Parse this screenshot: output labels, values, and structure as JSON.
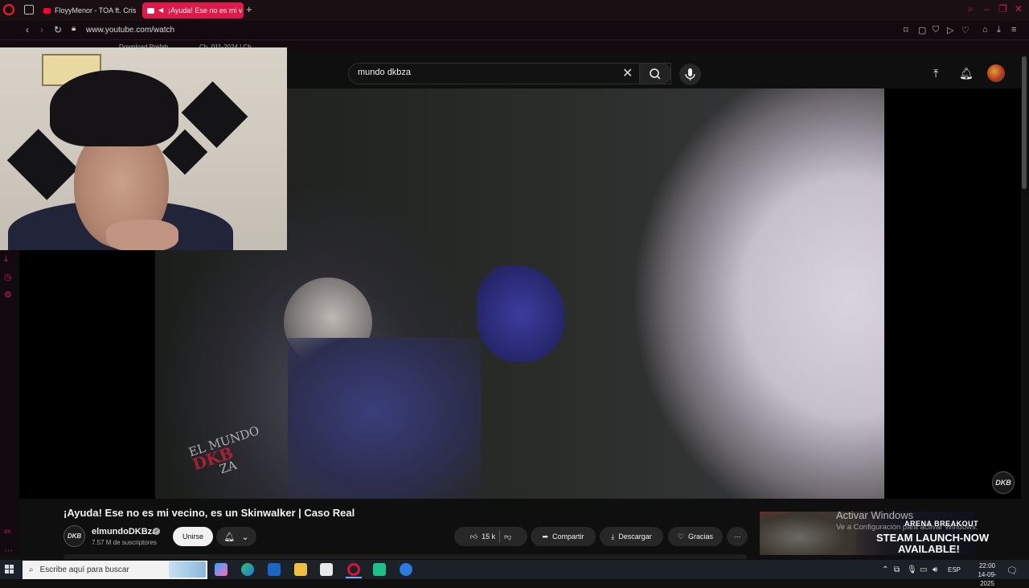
{
  "browser": {
    "tabs": [
      {
        "label": "FloyyMenor - TOA ft. Cris"
      },
      {
        "label": "¡Ayuda! Ese no es mi v"
      }
    ],
    "url": "www.youtube.com/watch",
    "bookmarks": [
      "Download Prefab",
      "Ch. 011-2024 | Ch"
    ],
    "accent_color": "#ff1b2d"
  },
  "youtube": {
    "search": {
      "value": "mundo dkbza"
    },
    "video": {
      "title": "¡Ayuda! Ese no es mi vecino, es un Skinwalker | Caso Real",
      "watermark_top": "EL MUNDO",
      "watermark_brand": "DKB",
      "watermark_bottom": "ZA",
      "corner_badge": "DKB"
    },
    "channel": {
      "avatar_text": "DKB",
      "name": "elmundoDKBza",
      "subscribers": "7.57 M de suscriptores",
      "join_label": "Unirse"
    },
    "actions": {
      "likes": "15 k",
      "share_label": "Compartir",
      "download_label": "Descargar",
      "thanks_label": "Gracias"
    },
    "ad": {
      "game": "ARENA BREAKOUT",
      "line1": "STEAM LAUNCH-NOW",
      "line2": "AVAILABLE!"
    }
  },
  "windows": {
    "activation_title": "Activar Windows",
    "activation_sub": "Ve a Configuración para activar Windows.",
    "taskbar_search_placeholder": "Escribe aquí para buscar",
    "language": "ESP",
    "time": "22:00",
    "date": "14-09-2025"
  }
}
